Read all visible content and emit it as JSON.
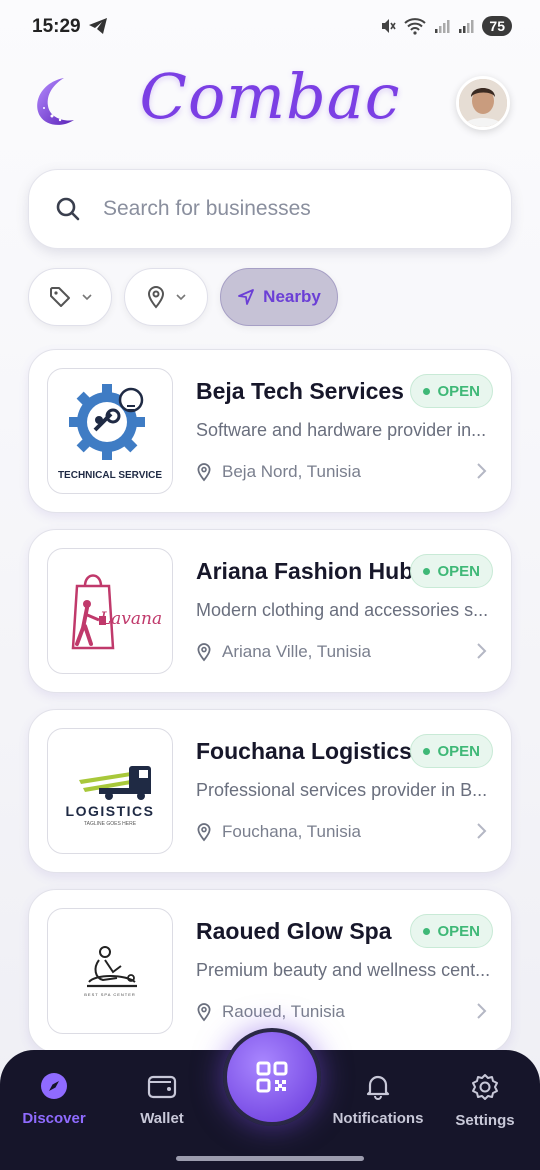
{
  "status_bar": {
    "time": "15:29",
    "battery": "75"
  },
  "header": {
    "brand": "Combac"
  },
  "search": {
    "placeholder": "Search for businesses"
  },
  "filters": {
    "nearby_label": "Nearby"
  },
  "businesses": [
    {
      "name": "Beja Tech Services",
      "status": "OPEN",
      "description": "Software and hardware provider in...",
      "location": "Beja Nord, Tunisia",
      "logo_text": "TECHNICAL SERVICE"
    },
    {
      "name": "Ariana Fashion Hub",
      "status": "OPEN",
      "description": "Modern clothing and accessories s...",
      "location": "Ariana Ville, Tunisia",
      "logo_text": "Lavana"
    },
    {
      "name": "Fouchana Logistics",
      "status": "OPEN",
      "description": "Professional services provider in B...",
      "location": "Fouchana, Tunisia",
      "logo_text": "LOGISTICS",
      "logo_subtext": "TAGLINE GOES HERE"
    },
    {
      "name": "Raoued Glow Spa",
      "status": "OPEN",
      "description": "Premium beauty and wellness cent...",
      "location": "Raoued, Tunisia",
      "logo_text": "BEST SPA CENTER"
    }
  ],
  "bottom_nav": {
    "discover": "Discover",
    "wallet": "Wallet",
    "notifications": "Notifications",
    "settings": "Settings"
  },
  "colors": {
    "accent": "#7b3fe4",
    "open_green": "#3fb877",
    "nav_bg": "#16152a"
  }
}
